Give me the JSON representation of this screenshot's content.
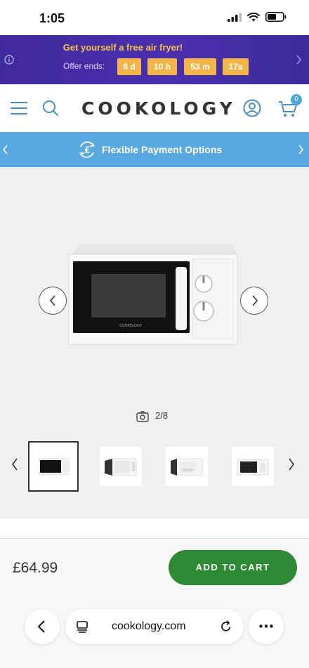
{
  "status_bar": {
    "time": "1:05"
  },
  "promo": {
    "title": "Get yourself a free air fryer!",
    "offer_label": "Offer ends:",
    "timer": [
      "8 d",
      "10 h",
      "53 m",
      "17s"
    ],
    "accent_color": "#f4b547",
    "background_color": "#4a2fb0"
  },
  "header": {
    "logo": "COOKOLOGY",
    "cart_count": "0"
  },
  "payment_banner": {
    "label": "Flexible Payment Options",
    "background_color": "#5aa8e1"
  },
  "gallery": {
    "counter": "2/8",
    "thumbnails": [
      "microwave-front-thumb",
      "microwave-door-open-thumb",
      "microwave-interior-thumb",
      "microwave-angle-thumb"
    ]
  },
  "buy_bar": {
    "price": "£64.99",
    "add_to_cart_label": "ADD TO CART",
    "button_color": "#2f8a35"
  },
  "browser": {
    "url": "cookology.com"
  }
}
